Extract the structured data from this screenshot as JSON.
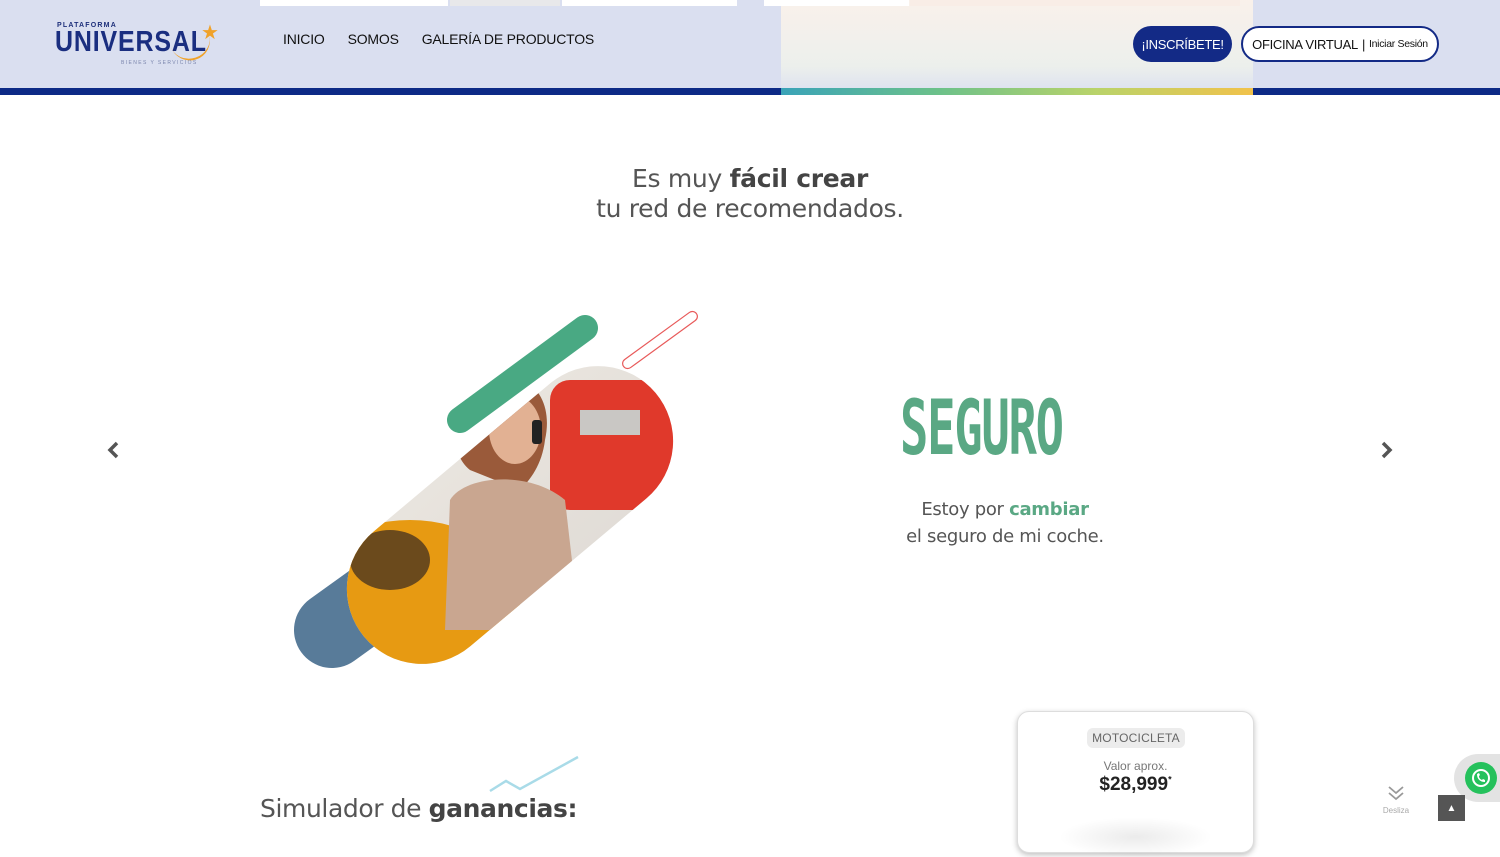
{
  "header": {
    "logo": {
      "top_text": "PLATAFORMA",
      "name": "UNIVERSAL",
      "tagline": "BIENES Y SERVICIOS"
    },
    "nav": [
      {
        "label": "INICIO"
      },
      {
        "label": "SOMOS"
      },
      {
        "label": "GALERÍA DE PRODUCTOS"
      }
    ],
    "signup_label": "¡INSCRÍBETE!",
    "office_label": "OFICINA VIRTUAL",
    "office_separator": "|",
    "office_login": "Iniciar Sesión"
  },
  "headline": {
    "line1_prefix": "Es muy ",
    "line1_bold": "fácil crear",
    "line2": "tu red de recomendados."
  },
  "slider": {
    "prev_icon": "chevron-left-icon",
    "next_icon": "chevron-right-icon",
    "title": "SEGURO",
    "text_prefix": "Estoy por ",
    "text_highlight": "cambiar",
    "text_line2": "el seguro de mi coche."
  },
  "simulator": {
    "title_prefix": "Simulador de ",
    "title_bold": "ganancias:"
  },
  "card": {
    "tag": "MOTOCICLETA",
    "label": "Valor aprox.",
    "price": "$28,999",
    "price_mark": "*"
  },
  "floating": {
    "whatsapp_icon": "whatsapp-icon",
    "scroll_text": "Desliza",
    "to_top_icon": "arrow-up-icon"
  },
  "colors": {
    "brand_navy": "#132a86",
    "brand_green": "#5aa884",
    "header_bg": "#dadff0",
    "accent_orange": "#f0a22a"
  }
}
